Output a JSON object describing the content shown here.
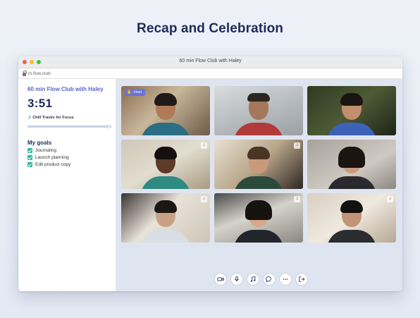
{
  "headline": "Recap and Celebration",
  "window": {
    "title": "60 min Flow Club with Haley",
    "url": "in.flow.club",
    "traffic_lights": [
      "#ee5f57",
      "#f5bd2e",
      "#38c84a"
    ]
  },
  "sidebar": {
    "session_title": "60 min Flow Club with Haley",
    "timer": "3:51",
    "music_icon": "music-note-icon",
    "music_label": "Chill Tracks for Focus",
    "music_progress": 0.97,
    "goals_heading": "My goals",
    "goals": [
      {
        "text": "Journaling",
        "done": true
      },
      {
        "text": "Launch planning",
        "done": true
      },
      {
        "text": "Edit product copy",
        "done": true
      }
    ]
  },
  "video_grid": {
    "host_badge": "Host",
    "tiles": [
      {
        "position": "top-left",
        "host": true,
        "muted_icon": false
      },
      {
        "position": "top-center",
        "host": false,
        "muted_icon": false
      },
      {
        "position": "top-right",
        "host": false,
        "muted_icon": false
      },
      {
        "position": "middle-left",
        "host": false,
        "muted_icon": true
      },
      {
        "position": "middle-center",
        "host": false,
        "muted_icon": true
      },
      {
        "position": "middle-right",
        "host": false,
        "muted_icon": false
      },
      {
        "position": "bottom-left",
        "host": false,
        "muted_icon": true
      },
      {
        "position": "bottom-center",
        "host": false,
        "muted_icon": true
      },
      {
        "position": "bottom-right",
        "host": false,
        "muted_icon": true
      }
    ]
  },
  "controls": [
    "camera-icon",
    "microphone-icon",
    "music-icon",
    "chat-icon",
    "more-icon",
    "leave-icon"
  ],
  "colors": {
    "accent": "#5a63c9",
    "navy": "#1e2a5a",
    "check": "#2fb9a0",
    "host_badge": "#6a72d9"
  }
}
